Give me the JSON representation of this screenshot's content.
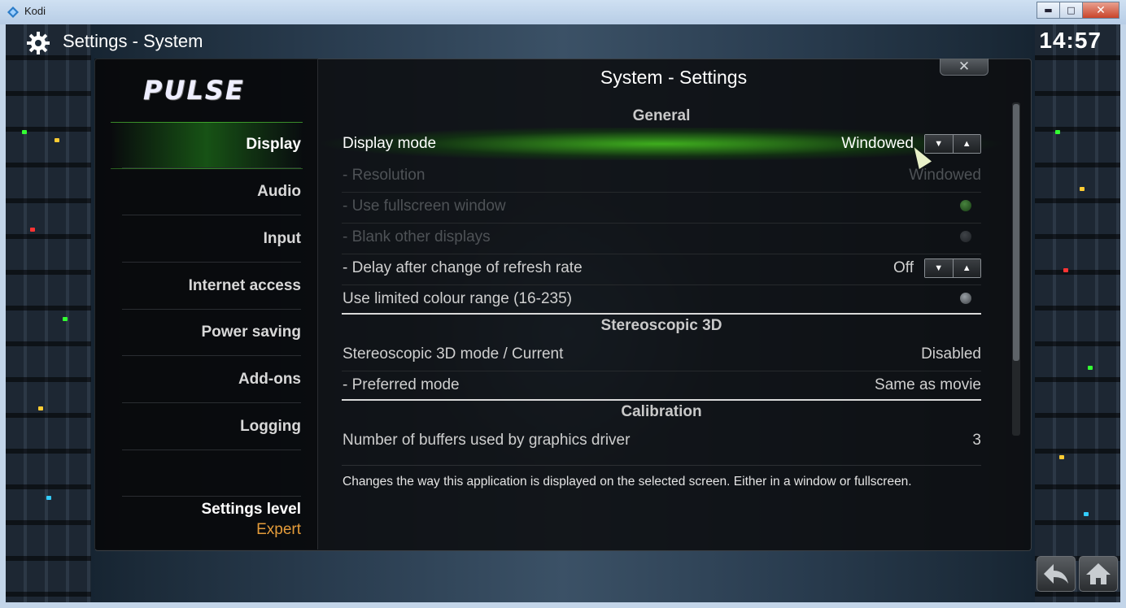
{
  "window": {
    "title": "Kodi",
    "minimize": "▬",
    "maximize": "□",
    "close": "✕"
  },
  "header": {
    "title": "Settings",
    "subtitle": "- System",
    "clock": "14:57"
  },
  "logo": "PULSE",
  "dialog": {
    "title": "System - Settings",
    "close_label": "✕"
  },
  "sidebar": {
    "items": [
      {
        "label": "Display",
        "active": true
      },
      {
        "label": "Audio"
      },
      {
        "label": "Input"
      },
      {
        "label": "Internet access"
      },
      {
        "label": "Power saving"
      },
      {
        "label": "Add-ons"
      },
      {
        "label": "Logging"
      }
    ],
    "settings_level_label": "Settings level",
    "settings_level_value": "Expert"
  },
  "sections": {
    "general": "General",
    "stereo": "Stereoscopic 3D",
    "calibration": "Calibration"
  },
  "settings": {
    "display_mode": {
      "label": "Display mode",
      "value": "Windowed"
    },
    "resolution": {
      "label": "- Resolution",
      "value": "Windowed"
    },
    "fullscreen_window": {
      "label": "- Use fullscreen window"
    },
    "blank_displays": {
      "label": "- Blank other displays"
    },
    "refresh_delay": {
      "label": "- Delay after change of refresh rate",
      "value": "Off"
    },
    "limited_colour": {
      "label": "Use limited colour range (16-235)"
    },
    "stereo_mode": {
      "label": "Stereoscopic 3D mode / Current",
      "value": "Disabled"
    },
    "preferred_mode": {
      "label": "- Preferred mode",
      "value": "Same as movie"
    },
    "buffers": {
      "label": "Number of buffers used by graphics driver",
      "value": "3"
    }
  },
  "description": "Changes the way this application is displayed on the selected screen. Either in a window or fullscreen.",
  "spinner": {
    "down": "▼",
    "up": "▲"
  },
  "colors": {
    "accent_green": "#3fbf2a",
    "level_orange": "#e39b3a"
  }
}
